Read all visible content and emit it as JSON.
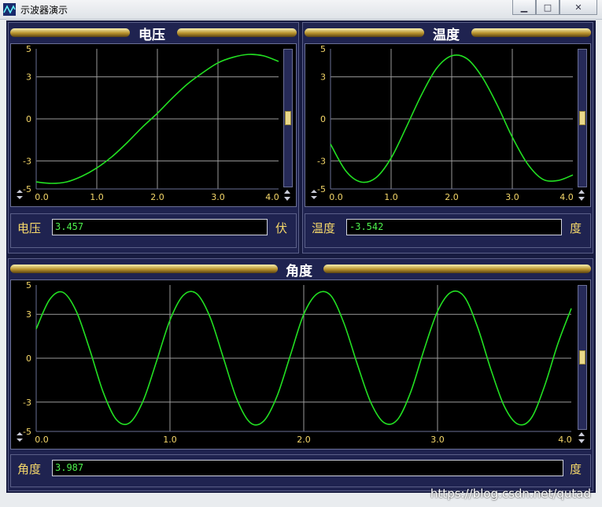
{
  "window": {
    "title": "示波器演示"
  },
  "colors": {
    "trace": "#22e022",
    "grid": "#9a9a9a",
    "tick": "#f6d86a"
  },
  "panels": {
    "voltage": {
      "title": "电压",
      "label": "电压",
      "value": "3.457",
      "unit": "伏"
    },
    "temperature": {
      "title": "温度",
      "label": "温度",
      "value": "-3.542",
      "unit": "度"
    },
    "angle": {
      "title": "角度",
      "label": "角度",
      "value": "3.987",
      "unit": "度"
    }
  },
  "chart_data": [
    {
      "type": "line",
      "name_ref": "voltage",
      "x_ticks": [
        "0.0",
        "1.0",
        "2.0",
        "3.0",
        "4.0"
      ],
      "y_ticks": [
        "5",
        "3",
        "0",
        "-3",
        "-5"
      ],
      "xlim": [
        0,
        4
      ],
      "ylim": [
        -5,
        5
      ],
      "grid": true,
      "x": [
        0.0,
        0.25,
        0.5,
        0.75,
        1.0,
        1.25,
        1.5,
        1.75,
        2.0,
        2.25,
        2.5,
        2.75,
        3.0,
        3.25,
        3.5,
        3.75,
        4.0
      ],
      "y": [
        -4.5,
        -4.6,
        -4.5,
        -4.1,
        -3.5,
        -2.7,
        -1.7,
        -0.6,
        0.4,
        1.5,
        2.5,
        3.3,
        4.0,
        4.4,
        4.6,
        4.5,
        4.1
      ]
    },
    {
      "type": "line",
      "name_ref": "temperature",
      "x_ticks": [
        "0.0",
        "1.0",
        "2.0",
        "3.0",
        "4.0"
      ],
      "y_ticks": [
        "5",
        "3",
        "0",
        "-3",
        "-5"
      ],
      "xlim": [
        0,
        4
      ],
      "ylim": [
        -5,
        5
      ],
      "grid": true,
      "x": [
        0.0,
        0.25,
        0.5,
        0.75,
        1.0,
        1.25,
        1.5,
        1.75,
        2.0,
        2.25,
        2.5,
        2.75,
        3.0,
        3.25,
        3.5,
        3.75,
        4.0
      ],
      "y": [
        -1.8,
        -3.7,
        -4.5,
        -4.2,
        -2.8,
        -0.6,
        1.7,
        3.6,
        4.5,
        4.3,
        3.0,
        1.0,
        -1.3,
        -3.2,
        -4.3,
        -4.4,
        -4.0
      ]
    },
    {
      "type": "line",
      "name_ref": "angle",
      "x_ticks": [
        "0.0",
        "1.0",
        "2.0",
        "3.0",
        "4.0"
      ],
      "y_ticks": [
        "5",
        "3",
        "0",
        "-3",
        "-5"
      ],
      "xlim": [
        0,
        4
      ],
      "ylim": [
        -5,
        5
      ],
      "grid": true,
      "x": [
        0.0,
        0.1,
        0.2,
        0.3,
        0.4,
        0.5,
        0.6,
        0.7,
        0.8,
        0.9,
        1.0,
        1.1,
        1.2,
        1.3,
        1.4,
        1.5,
        1.6,
        1.7,
        1.8,
        1.9,
        2.0,
        2.1,
        2.2,
        2.3,
        2.4,
        2.5,
        2.6,
        2.7,
        2.8,
        2.9,
        3.0,
        3.1,
        3.2,
        3.3,
        3.4,
        3.5,
        3.6,
        3.7,
        3.8,
        3.9,
        4.0
      ],
      "y": [
        2.0,
        4.0,
        4.5,
        3.2,
        0.6,
        -2.3,
        -4.2,
        -4.4,
        -2.9,
        -0.2,
        2.6,
        4.3,
        4.4,
        2.8,
        0.0,
        -2.8,
        -4.4,
        -4.3,
        -2.6,
        0.2,
        3.0,
        4.4,
        4.3,
        2.4,
        -0.4,
        -3.0,
        -4.4,
        -4.2,
        -2.3,
        0.6,
        3.2,
        4.5,
        4.2,
        2.1,
        -0.8,
        -3.3,
        -4.5,
        -4.1,
        -1.9,
        1.0,
        3.4
      ]
    }
  ],
  "watermark": "https://blog.csdn.net/qutad"
}
